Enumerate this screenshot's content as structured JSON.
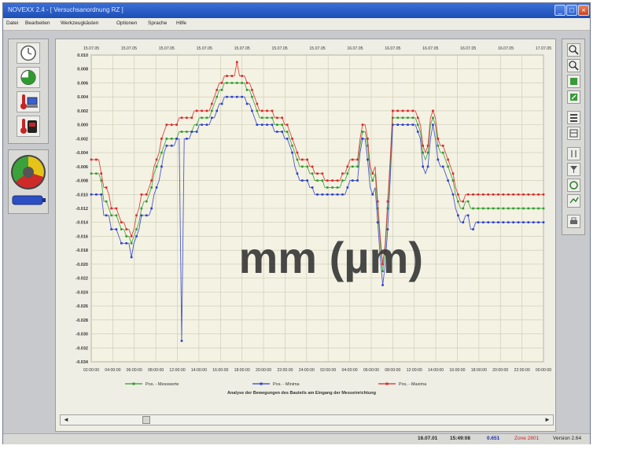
{
  "window": {
    "title": "NOVEXX 2.4 - [ Versuchsanordnung RZ ]",
    "buttons": {
      "minimize": "_",
      "maximize": "□",
      "close": "×"
    }
  },
  "menu": [
    "Datei",
    "Bearbeiten",
    "Werkzeugkästen",
    "Optionen",
    "Sprache",
    "Hilfe"
  ],
  "scroll": {
    "left": "◄",
    "right": "►"
  },
  "status": {
    "date": "16.07.01",
    "time": "15:49:08",
    "value": "0.651",
    "zone": "Zone 2801",
    "version": "Version 2.64"
  },
  "chart_data": {
    "type": "line",
    "overlay_text": "mm (µm)",
    "annotation": "Analyse der Bewegungen des Bauteils am Eingang der Messeinrichtung",
    "top_ticks": [
      "15.07.05",
      "15.07.05",
      "15.07.05",
      "15.07.05",
      "15.07.05",
      "15.07.05",
      "15.07.05",
      "16.07.05",
      "16.07.05",
      "16.07.05",
      "16.07.05",
      "16.07.05",
      "17.07.05"
    ],
    "x_ticks": [
      "02:00:00",
      "04:00:00",
      "06:00:00",
      "08:00:00",
      "12:00:00",
      "14:00:00",
      "16:00:00",
      "18:00:00",
      "20:00:00",
      "22:00:00",
      "24:00:00",
      "02:00:00",
      "04:00:00",
      "06:00:00",
      "08:00:00",
      "12:00:00",
      "14:00:00",
      "16:00:00",
      "18:00:00",
      "20:00:00",
      "22:00:00",
      "00:00:00"
    ],
    "y_ticks": [
      "0.010",
      "0.008",
      "0.006",
      "0.004",
      "0.002",
      "0.000",
      "-0.002",
      "-0.004",
      "-0.006",
      "-0.008",
      "-0.010",
      "-0.012",
      "-0.014",
      "-0.016",
      "-0.018",
      "-0.020",
      "-0.022",
      "-0.024",
      "-0.026",
      "-0.028",
      "-0.030",
      "-0.032",
      "-0.034"
    ],
    "ylim": [
      -0.034,
      0.01
    ],
    "grid": true,
    "legend_position": "bottom",
    "x": [
      0,
      1,
      2,
      3,
      4,
      5,
      6,
      7,
      8,
      9,
      10,
      11,
      12,
      13,
      14,
      15,
      16,
      17,
      18,
      19,
      20,
      21,
      22,
      23,
      24,
      25,
      26,
      27,
      28,
      29,
      30,
      31,
      32,
      33,
      34,
      35,
      36,
      37,
      38,
      39,
      40,
      41,
      42,
      43,
      44,
      45,
      46,
      47,
      48,
      49,
      50,
      51,
      52,
      53,
      54,
      55,
      56,
      57,
      58,
      59,
      60,
      61,
      62,
      63,
      64,
      65,
      66,
      67,
      68,
      69,
      70,
      71,
      72,
      73,
      74,
      75,
      76,
      77,
      78,
      79,
      80,
      81,
      82,
      83,
      84,
      85,
      86,
      87,
      88,
      89,
      90,
      91,
      92,
      93,
      94,
      95,
      96,
      97,
      98,
      99,
      100,
      101,
      102,
      103,
      104,
      105,
      106,
      107,
      108,
      109,
      110,
      111,
      112,
      113,
      114,
      115,
      116,
      117,
      118,
      119,
      120,
      121,
      122,
      123,
      124,
      125,
      126,
      127,
      128,
      129,
      130,
      131,
      132,
      133,
      134,
      135,
      136,
      137,
      138,
      139,
      140,
      141,
      142,
      143,
      144,
      145,
      146,
      147,
      148,
      149,
      150,
      151,
      152,
      153,
      154,
      155,
      156,
      157,
      158,
      159,
      160,
      161,
      162,
      163,
      164,
      165,
      166,
      167,
      168,
      169,
      170,
      171,
      172,
      173,
      174,
      175,
      176,
      177,
      178,
      179,
      180
    ],
    "series": [
      {
        "name": "Pos. - Messwerte",
        "color": "#2f9a2f",
        "values": [
          -0.007,
          -0.007,
          -0.007,
          -0.007,
          -0.008,
          -0.011,
          -0.011,
          -0.012,
          -0.013,
          -0.013,
          -0.013,
          -0.014,
          -0.015,
          -0.015,
          -0.016,
          -0.016,
          -0.017,
          -0.016,
          -0.015,
          -0.014,
          -0.012,
          -0.011,
          -0.011,
          -0.01,
          -0.009,
          -0.007,
          -0.006,
          -0.005,
          -0.004,
          -0.003,
          -0.002,
          -0.002,
          -0.002,
          -0.002,
          -0.002,
          -0.001,
          -0.001,
          -0.001,
          -0.001,
          -0.001,
          -0.001,
          0.0,
          0.0,
          0.001,
          0.001,
          0.001,
          0.001,
          0.001,
          0.002,
          0.003,
          0.004,
          0.005,
          0.005,
          0.006,
          0.006,
          0.006,
          0.006,
          0.006,
          0.006,
          0.006,
          0.006,
          0.006,
          0.005,
          0.005,
          0.004,
          0.003,
          0.002,
          0.001,
          0.001,
          0.001,
          0.001,
          0.001,
          0.001,
          0.0,
          0.0,
          0.0,
          0.0,
          -0.001,
          -0.001,
          -0.002,
          -0.003,
          -0.004,
          -0.005,
          -0.006,
          -0.006,
          -0.006,
          -0.006,
          -0.007,
          -0.007,
          -0.008,
          -0.008,
          -0.008,
          -0.008,
          -0.009,
          -0.009,
          -0.009,
          -0.009,
          -0.009,
          -0.009,
          -0.009,
          -0.008,
          -0.008,
          -0.007,
          -0.006,
          -0.006,
          -0.006,
          -0.006,
          -0.003,
          -0.001,
          -0.001,
          -0.003,
          -0.007,
          -0.008,
          -0.007,
          -0.012,
          -0.017,
          -0.021,
          -0.018,
          -0.012,
          -0.006,
          0.001,
          0.001,
          0.001,
          0.001,
          0.001,
          0.001,
          0.001,
          0.001,
          0.001,
          0.001,
          0.0,
          -0.001,
          -0.004,
          -0.005,
          -0.004,
          0.0,
          0.001,
          0.0,
          -0.003,
          -0.004,
          -0.004,
          -0.005,
          -0.006,
          -0.007,
          -0.008,
          -0.01,
          -0.011,
          -0.012,
          -0.012,
          -0.011,
          -0.011,
          -0.012,
          -0.012,
          -0.012,
          -0.012,
          -0.012,
          -0.012,
          -0.012,
          -0.012,
          -0.012,
          -0.012,
          -0.012,
          -0.012,
          -0.012,
          -0.012,
          -0.012,
          -0.012,
          -0.012,
          -0.012,
          -0.012,
          -0.012,
          -0.012,
          -0.012,
          -0.012,
          -0.012,
          -0.012,
          -0.012,
          -0.012,
          -0.012,
          -0.012,
          -0.012
        ]
      },
      {
        "name": "Pos. - Minima",
        "color": "#2b3fc9",
        "values": [
          -0.01,
          -0.01,
          -0.01,
          -0.01,
          -0.01,
          -0.013,
          -0.013,
          -0.013,
          -0.015,
          -0.015,
          -0.015,
          -0.016,
          -0.017,
          -0.017,
          -0.017,
          -0.017,
          -0.019,
          -0.017,
          -0.016,
          -0.015,
          -0.013,
          -0.013,
          -0.013,
          -0.013,
          -0.012,
          -0.01,
          -0.009,
          -0.008,
          -0.006,
          -0.004,
          -0.003,
          -0.003,
          -0.003,
          -0.003,
          -0.002,
          -0.002,
          -0.031,
          -0.002,
          -0.002,
          -0.002,
          -0.001,
          -0.001,
          -0.001,
          0.0,
          0.0,
          0.0,
          0.0,
          0.0,
          0.001,
          0.001,
          0.002,
          0.003,
          0.003,
          0.004,
          0.004,
          0.004,
          0.004,
          0.004,
          0.004,
          0.004,
          0.004,
          0.004,
          0.003,
          0.003,
          0.002,
          0.001,
          0.0,
          0.0,
          0.0,
          0.0,
          0.0,
          0.0,
          0.0,
          -0.001,
          -0.001,
          -0.001,
          -0.001,
          -0.002,
          -0.002,
          -0.003,
          -0.004,
          -0.006,
          -0.007,
          -0.008,
          -0.008,
          -0.008,
          -0.008,
          -0.009,
          -0.009,
          -0.01,
          -0.01,
          -0.01,
          -0.01,
          -0.01,
          -0.01,
          -0.01,
          -0.01,
          -0.01,
          -0.01,
          -0.01,
          -0.01,
          -0.01,
          -0.009,
          -0.008,
          -0.008,
          -0.008,
          -0.008,
          -0.004,
          -0.002,
          -0.002,
          -0.005,
          -0.009,
          -0.01,
          -0.009,
          -0.014,
          -0.019,
          -0.023,
          -0.02,
          -0.015,
          -0.008,
          0.0,
          0.0,
          0.0,
          0.0,
          0.0,
          0.0,
          0.0,
          0.0,
          0.0,
          0.0,
          -0.001,
          -0.002,
          -0.006,
          -0.007,
          -0.006,
          -0.002,
          0.0,
          -0.002,
          -0.005,
          -0.006,
          -0.006,
          -0.007,
          -0.008,
          -0.009,
          -0.01,
          -0.012,
          -0.013,
          -0.014,
          -0.014,
          -0.013,
          -0.013,
          -0.015,
          -0.015,
          -0.014,
          -0.014,
          -0.014,
          -0.014,
          -0.014,
          -0.014,
          -0.014,
          -0.014,
          -0.014,
          -0.014,
          -0.014,
          -0.014,
          -0.014,
          -0.014,
          -0.014,
          -0.014,
          -0.014,
          -0.014,
          -0.014,
          -0.014,
          -0.014,
          -0.014,
          -0.014,
          -0.014,
          -0.014,
          -0.014,
          -0.014,
          -0.014
        ]
      },
      {
        "name": "Pos. - Maxima",
        "color": "#d62828",
        "values": [
          -0.005,
          -0.005,
          -0.005,
          -0.005,
          -0.007,
          -0.009,
          -0.009,
          -0.01,
          -0.012,
          -0.012,
          -0.012,
          -0.013,
          -0.014,
          -0.014,
          -0.015,
          -0.015,
          -0.016,
          -0.015,
          -0.013,
          -0.012,
          -0.01,
          -0.01,
          -0.01,
          -0.009,
          -0.008,
          -0.006,
          -0.005,
          -0.004,
          -0.002,
          -0.001,
          0.0,
          0.0,
          0.0,
          0.0,
          0.0,
          0.001,
          0.001,
          0.001,
          0.001,
          0.001,
          0.001,
          0.002,
          0.002,
          0.002,
          0.002,
          0.002,
          0.002,
          0.002,
          0.003,
          0.004,
          0.005,
          0.006,
          0.006,
          0.007,
          0.007,
          0.007,
          0.007,
          0.007,
          0.009,
          0.007,
          0.007,
          0.007,
          0.006,
          0.006,
          0.005,
          0.004,
          0.003,
          0.002,
          0.002,
          0.002,
          0.002,
          0.002,
          0.002,
          0.001,
          0.001,
          0.001,
          0.001,
          0.0,
          0.0,
          -0.001,
          -0.002,
          -0.003,
          -0.004,
          -0.005,
          -0.005,
          -0.005,
          -0.005,
          -0.006,
          -0.006,
          -0.007,
          -0.007,
          -0.007,
          -0.007,
          -0.008,
          -0.008,
          -0.008,
          -0.008,
          -0.008,
          -0.008,
          -0.008,
          -0.007,
          -0.007,
          -0.006,
          -0.005,
          -0.005,
          -0.005,
          -0.005,
          -0.002,
          0.0,
          0.0,
          -0.002,
          -0.006,
          -0.007,
          -0.006,
          -0.011,
          -0.016,
          -0.02,
          -0.017,
          -0.011,
          -0.005,
          0.002,
          0.002,
          0.002,
          0.002,
          0.002,
          0.002,
          0.002,
          0.002,
          0.002,
          0.002,
          0.001,
          0.0,
          -0.003,
          -0.004,
          -0.003,
          0.001,
          0.002,
          0.001,
          -0.002,
          -0.003,
          -0.003,
          -0.004,
          -0.005,
          -0.006,
          -0.007,
          -0.009,
          -0.01,
          -0.011,
          -0.011,
          -0.01,
          -0.01,
          -0.01,
          -0.01,
          -0.01,
          -0.01,
          -0.01,
          -0.01,
          -0.01,
          -0.01,
          -0.01,
          -0.01,
          -0.01,
          -0.01,
          -0.01,
          -0.01,
          -0.01,
          -0.01,
          -0.01,
          -0.01,
          -0.01,
          -0.01,
          -0.01,
          -0.01,
          -0.01,
          -0.01,
          -0.01,
          -0.01,
          -0.01,
          -0.01,
          -0.01,
          -0.01
        ]
      }
    ]
  }
}
